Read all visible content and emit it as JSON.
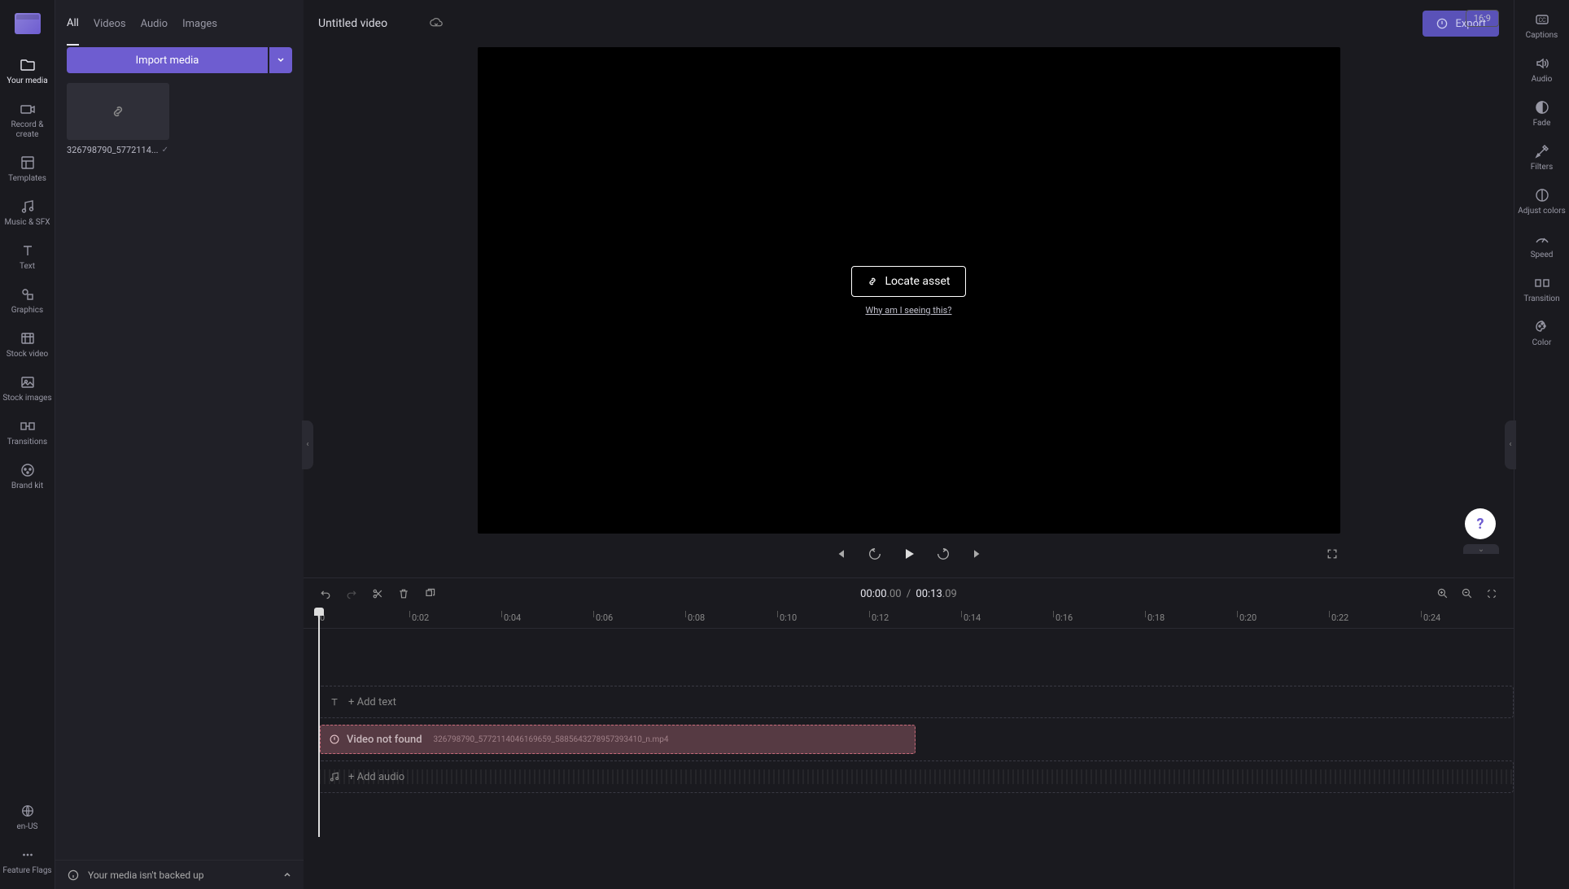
{
  "left_rail": {
    "items": [
      {
        "label": "Your media",
        "icon": "folder"
      },
      {
        "label": "Record & create",
        "icon": "camera"
      },
      {
        "label": "Templates",
        "icon": "template"
      },
      {
        "label": "Music & SFX",
        "icon": "music"
      },
      {
        "label": "Text",
        "icon": "text"
      },
      {
        "label": "Graphics",
        "icon": "graphics"
      },
      {
        "label": "Stock video",
        "icon": "stockvideo"
      },
      {
        "label": "Stock images",
        "icon": "stockimage"
      },
      {
        "label": "Transitions",
        "icon": "transition"
      },
      {
        "label": "Brand kit",
        "icon": "brandkit"
      }
    ],
    "bottom": [
      {
        "label": "en-US",
        "icon": "globe"
      },
      {
        "label": "Feature Flags",
        "icon": "dots"
      }
    ]
  },
  "media_panel": {
    "tabs": [
      "All",
      "Videos",
      "Audio",
      "Images"
    ],
    "active_tab": "All",
    "import_label": "Import media",
    "items": [
      {
        "name": "326798790_5772114...",
        "thumb": "link"
      }
    ],
    "backup_msg": "Your media isn't backed up"
  },
  "header": {
    "title": "Untitled video",
    "export_label": "Export",
    "aspect": "16:9"
  },
  "preview": {
    "locate_label": "Locate asset",
    "why_label": "Why am I seeing this?"
  },
  "right_rail": {
    "items": [
      {
        "label": "Captions",
        "icon": "cc"
      },
      {
        "label": "Audio",
        "icon": "audio"
      },
      {
        "label": "Fade",
        "icon": "fade"
      },
      {
        "label": "Filters",
        "icon": "filters"
      },
      {
        "label": "Adjust colors",
        "icon": "adjust"
      },
      {
        "label": "Speed",
        "icon": "speed"
      },
      {
        "label": "Transition",
        "icon": "transition-r"
      },
      {
        "label": "Color",
        "icon": "color"
      }
    ]
  },
  "timeline": {
    "current": "00:00",
    "current_ms": ".00",
    "sep": "/",
    "total": "00:13",
    "total_ms": ".09",
    "ticks": [
      "0",
      "0:02",
      "0:04",
      "0:06",
      "0:08",
      "0:10",
      "0:12",
      "0:14",
      "0:16",
      "0:18",
      "0:20",
      "0:22",
      "0:24"
    ],
    "text_track": "+ Add text",
    "video_track": {
      "title": "Video not found",
      "file": "326798790_5772114046169659_5885643278957393410_n.mp4"
    },
    "audio_track": "+ Add audio"
  },
  "help": "?"
}
